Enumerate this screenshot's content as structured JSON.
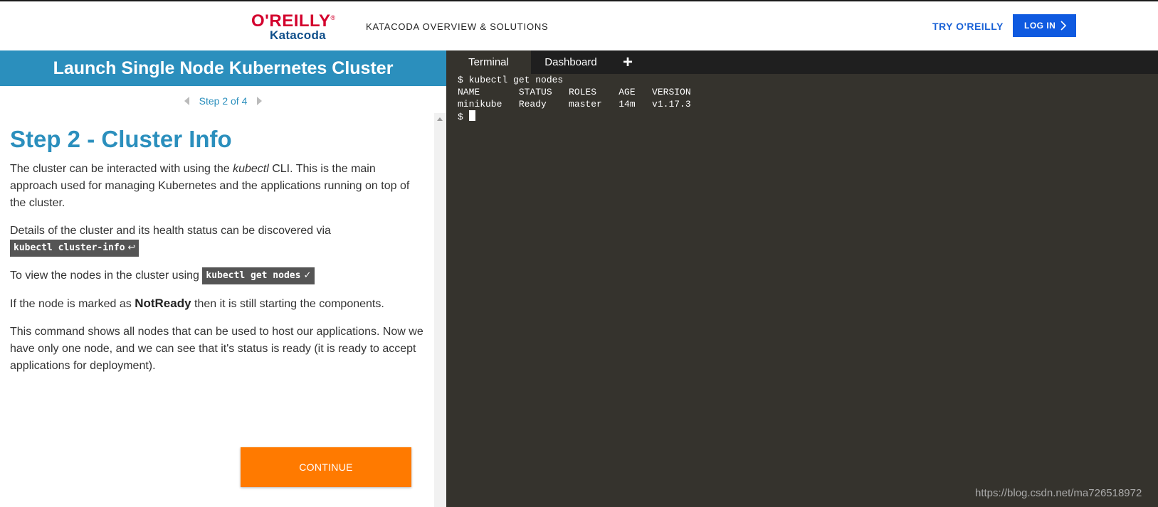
{
  "header": {
    "logo_brand": "O'REILLY",
    "logo_sub": "Katacoda",
    "nav_link": "KATACODA OVERVIEW & SOLUTIONS",
    "try_link": "TRY O'REILLY",
    "login_label": "LOG IN"
  },
  "scenario": {
    "title": "Launch Single Node Kubernetes Cluster",
    "step_indicator": "Step 2 of 4",
    "step_heading": "Step 2 - Cluster Info",
    "p1_before": "The cluster can be interacted with using the ",
    "p1_em": "kubectl",
    "p1_after": " CLI. This is the main approach used for managing Kubernetes and the applications running on top of the cluster.",
    "p2_text": "Details of the cluster and its health status can be discovered via",
    "p2_code": "kubectl cluster-info",
    "p2_code_symbol": "↩",
    "p3_text": "To view the nodes in the cluster using ",
    "p3_code": "kubectl get nodes",
    "p3_code_symbol": "✓",
    "p4_before": "If the node is marked as ",
    "p4_strong": "NotReady",
    "p4_after": " then it is still starting the components.",
    "p5_text": "This command shows all nodes that can be used to host our applications. Now we have only one node, and we can see that it's status is ready (it is ready to accept applications for deployment).",
    "continue_label": "CONTINUE"
  },
  "terminal": {
    "tabs": [
      "Terminal",
      "Dashboard"
    ],
    "add_tab": "+",
    "lines": [
      "$ kubectl get nodes",
      "NAME       STATUS   ROLES    AGE   VERSION",
      "minikube   Ready    master   14m   v1.17.3"
    ],
    "prompt": "$ "
  },
  "watermark": "https://blog.csdn.net/ma726518972",
  "colors": {
    "accent_blue": "#2b8fbd",
    "continue_orange": "#ff7a00",
    "login_blue": "#0f5ae0",
    "terminal_bg": "#35332d"
  }
}
